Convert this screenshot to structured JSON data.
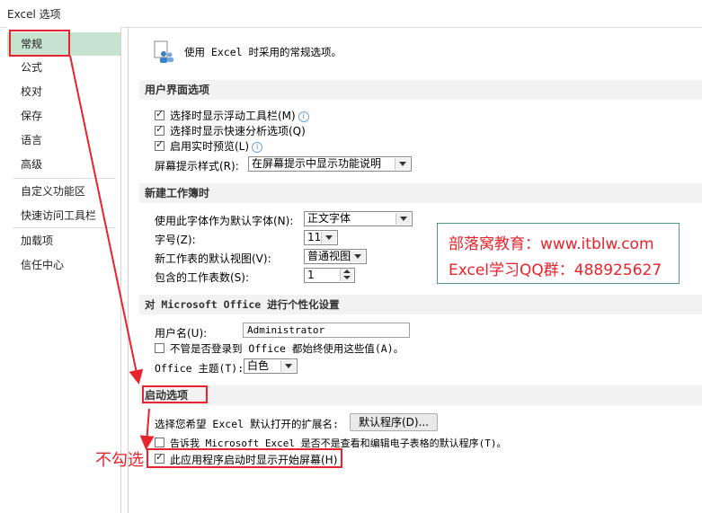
{
  "window": {
    "title": "Excel 选项"
  },
  "sidebar": {
    "items": [
      {
        "label": "常规",
        "active": true
      },
      {
        "label": "公式"
      },
      {
        "label": "校对"
      },
      {
        "label": "保存"
      },
      {
        "label": "语言"
      },
      {
        "label": "高级"
      },
      {
        "label": "自定义功能区"
      },
      {
        "label": "快速访问工具栏"
      },
      {
        "label": "加载项"
      },
      {
        "label": "信任中心"
      }
    ]
  },
  "intro": {
    "text": "使用 Excel 时采用的常规选项。",
    "icon": "people-settings-icon"
  },
  "ui_options": {
    "heading": "用户界面选项",
    "mini_toolbar": {
      "label": "选择时显示浮动工具栏(M)",
      "checked": true
    },
    "quick_analysis": {
      "label": "选择时显示快速分析选项(Q)",
      "checked": true
    },
    "live_preview": {
      "label": "启用实时预览(L)",
      "checked": true
    },
    "screentip_label": "屏幕提示样式(R):",
    "screentip_value": "在屏幕提示中显示功能说明"
  },
  "new_workbook": {
    "heading": "新建工作簿时",
    "font_label": "使用此字体作为默认字体(N):",
    "font_value": "正文字体",
    "size_label": "字号(Z):",
    "size_value": "11",
    "view_label": "新工作表的默认视图(V):",
    "view_value": "普通视图",
    "sheets_label": "包含的工作表数(S):",
    "sheets_value": "1"
  },
  "personalize": {
    "heading": "对 Microsoft Office 进行个性化设置",
    "username_label": "用户名(U):",
    "username_value": "Administrator",
    "always_use": {
      "label": "不管是否登录到 Office 都始终使用这些值(A)。",
      "checked": false
    },
    "theme_label": "Office 主题(T):",
    "theme_value": "白色"
  },
  "startup": {
    "heading": "启动选项",
    "extensions_label": "选择您希望 Excel 默认打开的扩展名:",
    "default_programs_button": "默认程序(D)...",
    "tell_me": {
      "label": "告诉我 Microsoft Excel 是否不是查看和编辑电子表格的默认程序(T)。",
      "checked": false
    },
    "show_start": {
      "label": "此应用程序启动时显示开始屏幕(H)",
      "checked": true
    }
  },
  "annotation": {
    "watermark_line1": "部落窝教育：www.itblw.com",
    "watermark_line2": "Excel学习QQ群：488925627",
    "uncheck_note": "不勾选",
    "accent": "#e8232c"
  }
}
